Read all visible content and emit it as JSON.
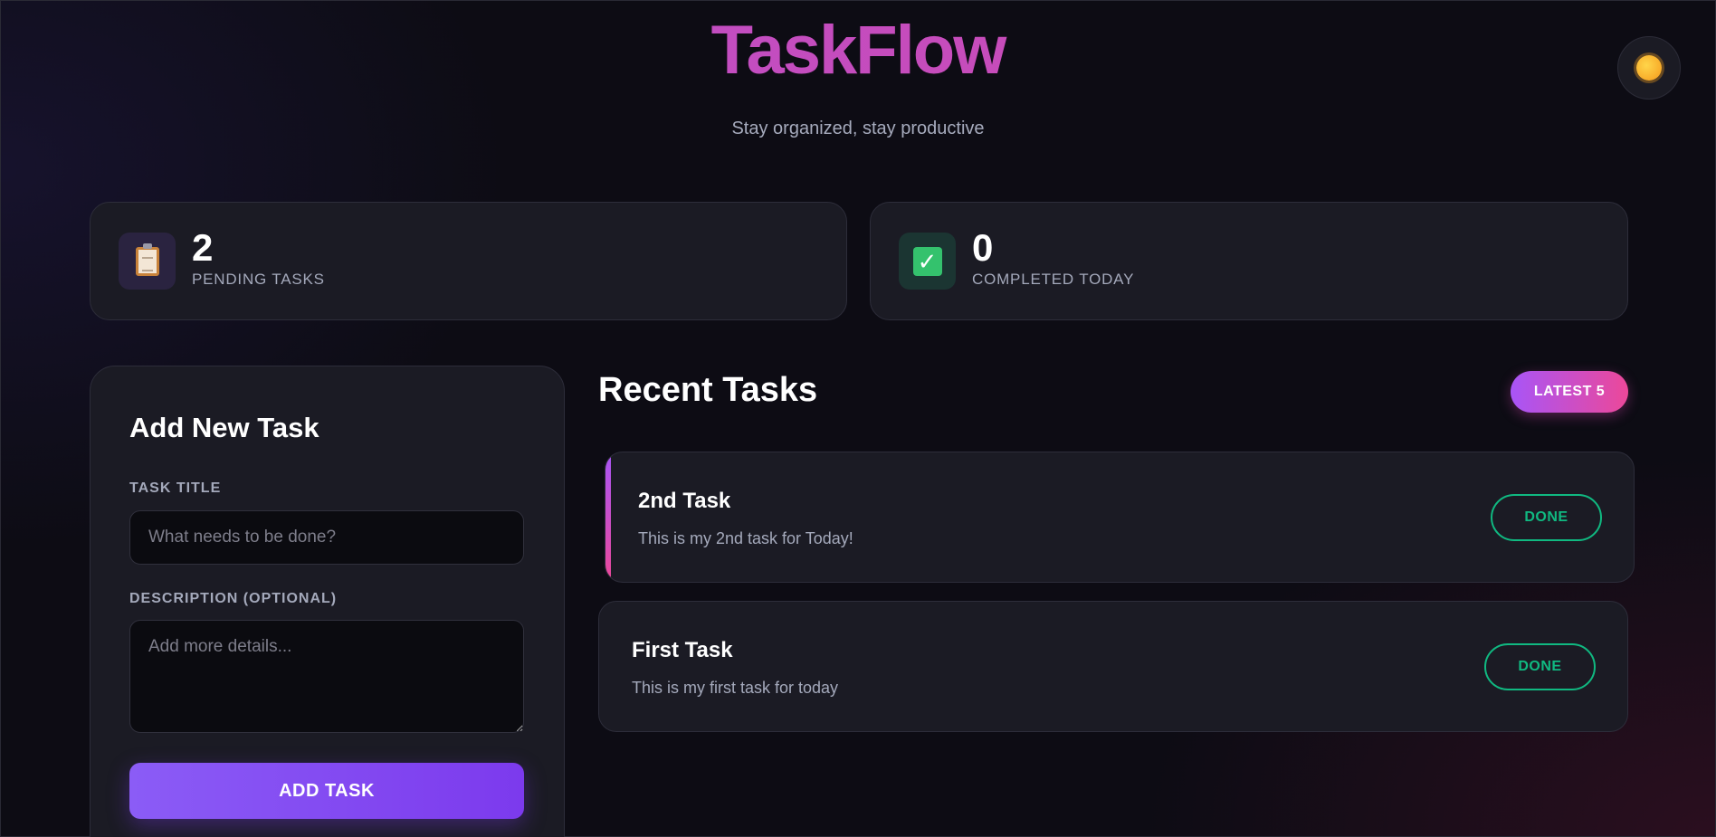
{
  "header": {
    "title": "TaskFlow",
    "subtitle": "Stay organized, stay productive",
    "theme_icon": "sun-icon"
  },
  "stats": [
    {
      "value": "2",
      "label": "PENDING TASKS",
      "icon": "clipboard-icon"
    },
    {
      "value": "0",
      "label": "COMPLETED TODAY",
      "icon": "check-box-icon"
    }
  ],
  "add_task": {
    "heading": "Add New Task",
    "title_label": "TASK TITLE",
    "title_placeholder": "What needs to be done?",
    "title_value": "",
    "description_label": "DESCRIPTION (OPTIONAL)",
    "description_placeholder": "Add more details...",
    "description_value": "",
    "button_label": "ADD TASK"
  },
  "recent": {
    "heading": "Recent Tasks",
    "badge": "LATEST 5",
    "tasks": [
      {
        "title": "2nd Task",
        "description": "This is my 2nd task for Today!",
        "action": "DONE"
      },
      {
        "title": "First Task",
        "description": "This is my first task for today",
        "action": "DONE"
      }
    ]
  },
  "colors": {
    "background": "#0d0c14",
    "card": "#1b1b24",
    "brand_gradient_start": "#b84fd0",
    "brand_gradient_end": "#d14aab",
    "primary_button": "#8b5cf6",
    "done_green": "#10b981",
    "badge_gradient_start": "#a855f7",
    "badge_gradient_end": "#ec4899"
  }
}
